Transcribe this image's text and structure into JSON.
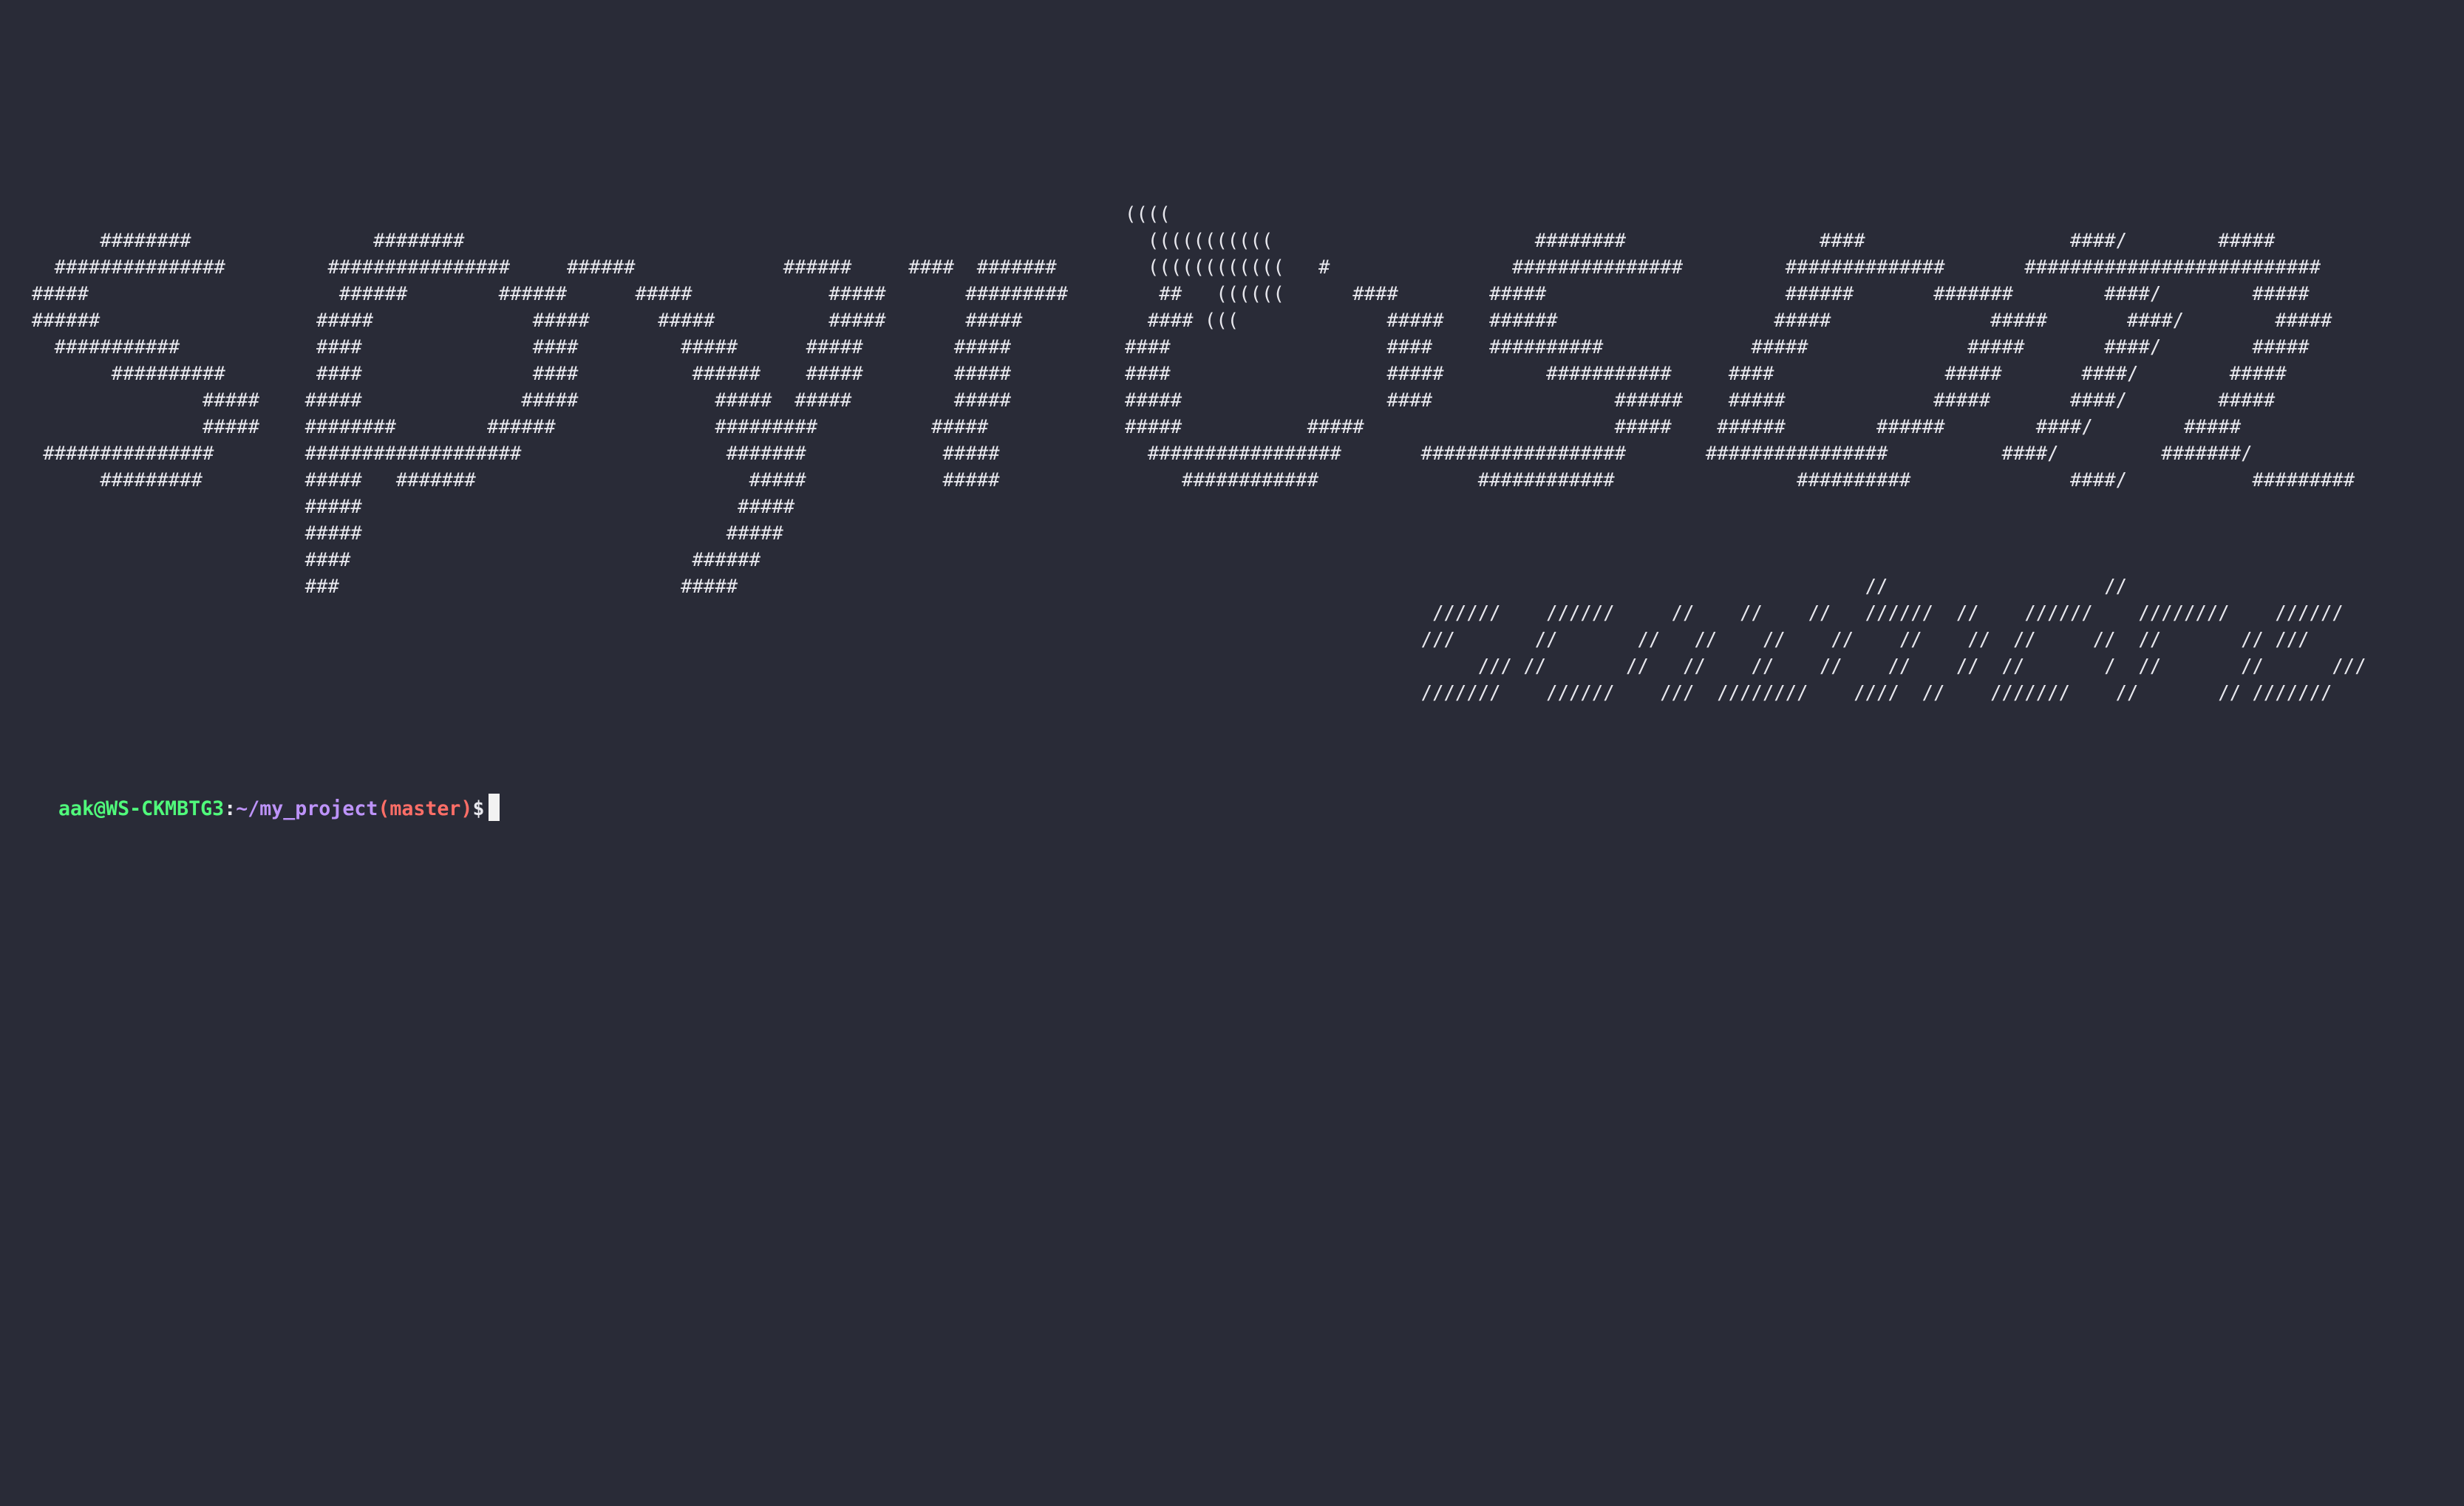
{
  "terminal": {
    "background": "#292b37",
    "foreground": "#e8e8ee",
    "banner": [
      "                                                                                                                                                                                                                                      ########",
      "                                                                                                                                                                                                                                    ######",
      "                                                                                                                                                                                                                                    ####(        ####",
      "                                                                                                  ((((                                                                                                                              ####/        #####",
      "        ########                ########                                                            (((((((((((                       ########                 ####                  ####/        #####",
      "    ###############         ################     ######             ######     ####  #######        ((((((((((((   #                ###############         ##############       ##########################",
      "  #####                      ######        ######      #####            #####       #########        ##   ((((((      ####        #####                     ######       #######        ####/        #####",
      "  ######                   #####              #####      #####          #####       #####           #### (((             #####    ######                   #####              #####       ####/        #####",
      "    ###########            ####               ####         #####      #####        #####          ####                   ####     ##########             #####              #####       ####/        #####",
      "         ##########        ####               ####          ######    #####        #####          ####                   #####         ###########     ####               #####       ####/        #####",
      "                 #####    #####              #####            #####  #####         #####          #####                  ####                ######    #####             #####       ####/        #####",
      "                 #####    ########        ######              #########          #####            #####           #####                      #####    ######        ######        ####/        #####",
      "   ###############        ###################                  #######            #####             #################       ##################       ################          ####/         #######/",
      "        #########         #####   #######                        #####            #####                ############              ############                ##########              ####/           #########",
      "                          #####                                 #####",
      "                          #####                                #####",
      "                          ####                              ######",
      "                          ###                              #####",
      "                                                                                                                                                                   //                   //",
      "                                                                                                                             //////    //////     //    //    //   //////  //    //////    ////////    //////",
      "                                                                                                                            ///       //       //   //    //    //    //    //  //     //  //       // ///",
      "                                                                                                                                 /// //       //   //    //    //    //    //  //       /  //       //      ///",
      "                                                                                                                            ///////    //////    ///  ////////    ////  //    ///////    //       // ///////"
    ],
    "prompt": {
      "user_host": "aak@WS-CKMBTG3",
      "colon": ":",
      "path": "~/my_project",
      "branch": "(master)",
      "dollar": "$"
    }
  }
}
